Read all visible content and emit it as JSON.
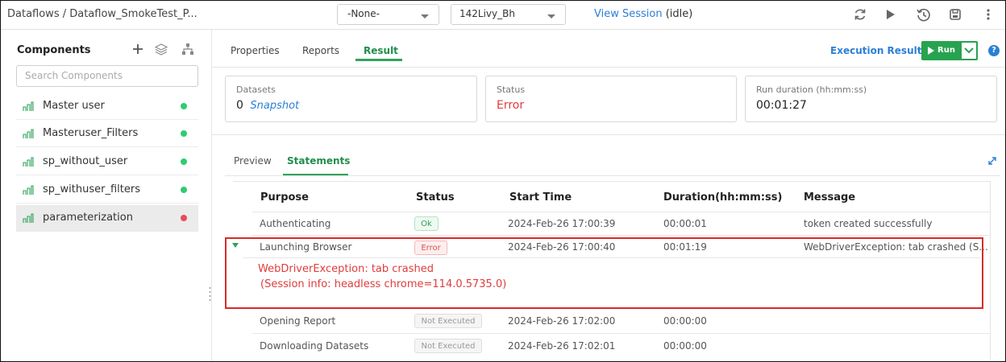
{
  "topbar": {
    "breadcrumb": "Dataflows / Dataflow_SmokeTest_P...",
    "select1_value": "-None-",
    "select2_value": "142Livy_Bh",
    "view_session": "View Session",
    "session_state": "(idle)"
  },
  "sidebar": {
    "title": "Components",
    "search_placeholder": "Search Components",
    "items": [
      {
        "label": "Master user",
        "status": "green"
      },
      {
        "label": "Masteruser_Filters",
        "status": "green"
      },
      {
        "label": "sp_without_user",
        "status": "green"
      },
      {
        "label": "sp_withuser_filters",
        "status": "green"
      },
      {
        "label": "parameterization",
        "status": "red"
      }
    ]
  },
  "tabs": [
    "Properties",
    "Reports",
    "Result"
  ],
  "actions": {
    "execution_results": "Execution Results",
    "run": "Run",
    "help": "?"
  },
  "cards": {
    "datasets_label": "Datasets",
    "datasets_count": "0",
    "datasets_link": "Snapshot",
    "status_label": "Status",
    "status_value": "Error",
    "duration_label": "Run duration (hh:mm:ss)",
    "duration_value": "00:01:27"
  },
  "subtabs": [
    "Preview",
    "Statements"
  ],
  "table": {
    "headers": [
      "Purpose",
      "Status",
      "Start Time",
      "Duration(hh:mm:ss)",
      "Message"
    ],
    "rows": [
      {
        "purpose": "Authenticating",
        "status": "Ok",
        "start": "2024-Feb-26 17:00:39",
        "duration": "00:00:01",
        "message": "token created successfully"
      },
      {
        "purpose": "Launching Browser",
        "status": "Error",
        "start": "2024-Feb-26 17:00:40",
        "duration": "00:01:19",
        "message": "WebDriverException: tab crashed (S..."
      },
      {
        "purpose": "Opening Report",
        "status": "Not Executed",
        "start": "2024-Feb-26 17:02:00",
        "duration": "00:00:00",
        "message": ""
      },
      {
        "purpose": "Downloading Datasets",
        "status": "Not Executed",
        "start": "2024-Feb-26 17:02:01",
        "duration": "00:00:00",
        "message": ""
      }
    ],
    "expanded_error_line1": "WebDriverException: tab crashed",
    "expanded_error_line2": "(Session info: headless chrome=114.0.5735.0)"
  },
  "colors": {
    "accent_green": "#27a34f",
    "link_blue": "#2b7fd6",
    "error_red": "#e03c3c",
    "status_green": "#2ecc71",
    "status_red": "#e74c5b"
  }
}
